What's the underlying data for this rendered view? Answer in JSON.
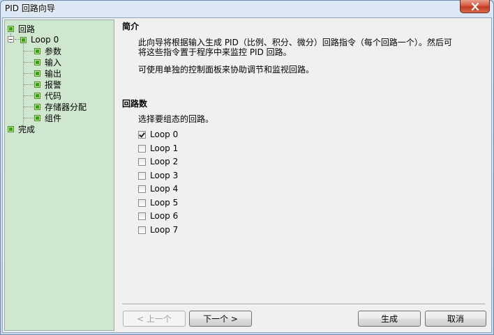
{
  "window": {
    "title": "PID 回路向导"
  },
  "tree": {
    "root": "回路",
    "loop": "Loop 0",
    "children": [
      "参数",
      "输入",
      "输出",
      "报警",
      "代码",
      "存储器分配",
      "组件"
    ],
    "finish": "完成"
  },
  "intro": {
    "title": "简介",
    "line1": "此向导将根据输入生成 PID（比例、积分、微分）回路指令（每个回路一个）。然后可",
    "line2": "将这些指令置于程序中来监控 PID 回路。",
    "line3": "可使用单独的控制面板来协助调节和监视回路。"
  },
  "loops": {
    "title": "回路数",
    "prompt": "选择要组态的回路。",
    "items": [
      {
        "label": "Loop 0",
        "checked": true
      },
      {
        "label": "Loop 1",
        "checked": false
      },
      {
        "label": "Loop 2",
        "checked": false
      },
      {
        "label": "Loop 3",
        "checked": false
      },
      {
        "label": "Loop 4",
        "checked": false
      },
      {
        "label": "Loop 5",
        "checked": false
      },
      {
        "label": "Loop 6",
        "checked": false
      },
      {
        "label": "Loop 7",
        "checked": false
      }
    ]
  },
  "buttons": {
    "prev": "< 上一个",
    "next": "下一个 >",
    "generate": "生成",
    "cancel": "取消"
  }
}
